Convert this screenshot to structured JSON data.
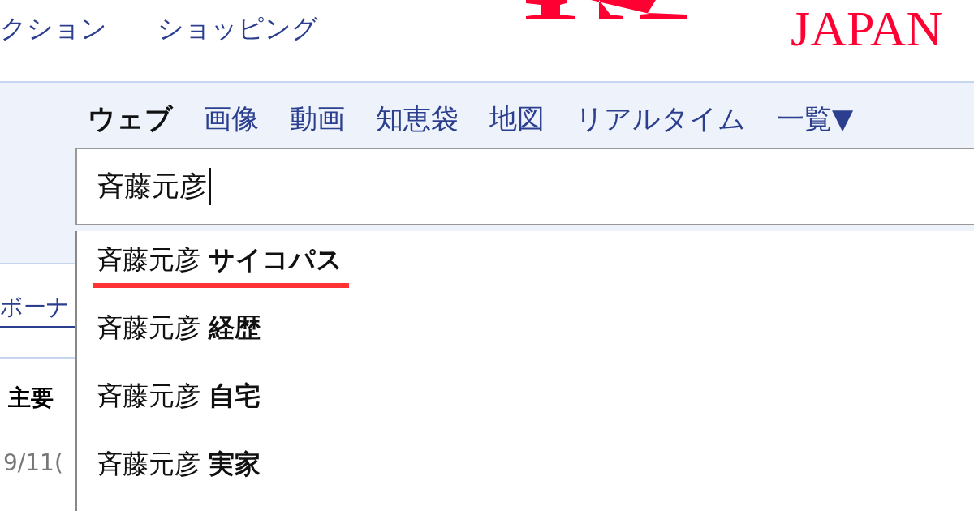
{
  "header": {
    "nav_links": [
      "クション",
      "ショッピング"
    ],
    "logo_text": "JAPAN"
  },
  "tabs": [
    {
      "label": "ウェブ",
      "selected": true
    },
    {
      "label": "画像",
      "selected": false
    },
    {
      "label": "動画",
      "selected": false
    },
    {
      "label": "知恵袋",
      "selected": false
    },
    {
      "label": "地図",
      "selected": false
    },
    {
      "label": "リアルタイム",
      "selected": false
    },
    {
      "label": "一覧▼",
      "selected": false
    }
  ],
  "search": {
    "value": "斉藤元彦"
  },
  "suggestions": [
    {
      "text": "斉藤元彦 **サイコパス**",
      "underlined": true
    },
    {
      "text": "斉藤元彦 **経歴**",
      "underlined": false
    },
    {
      "text": "斉藤元彦 **自宅**",
      "underlined": false
    },
    {
      "text": "斉藤元彦 **実家**",
      "underlined": false
    }
  ],
  "background": {
    "link": "ボーナ",
    "heading": "主要",
    "date": "9/11("
  }
}
